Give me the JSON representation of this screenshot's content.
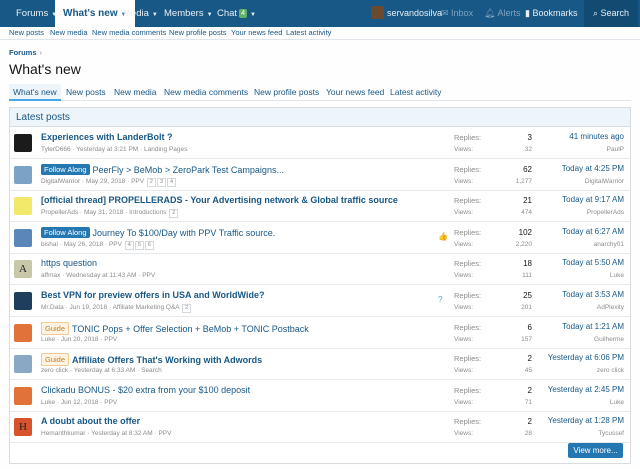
{
  "topnav": {
    "forums": "Forums",
    "whats_new": "What's new",
    "media": "Media",
    "members": "Members",
    "chat": "Chat",
    "chat_badge": "4",
    "user": "servandosilva",
    "inbox": "Inbox",
    "alerts": "Alerts",
    "bookmarks": "Bookmarks",
    "search": "Search"
  },
  "subnav": [
    "New posts",
    "New media",
    "New media comments",
    "New profile posts",
    "Your news feed",
    "Latest activity"
  ],
  "breadcrumb": "Forums",
  "page_title": "What's new",
  "tabs": [
    "What's new",
    "New posts",
    "New media",
    "New media comments",
    "New profile posts",
    "Your news feed",
    "Latest activity"
  ],
  "block_title": "Latest posts",
  "stat_labels": {
    "replies": "Replies:",
    "views": "Views:"
  },
  "threads": [
    {
      "label": "",
      "label_style": "",
      "title": "Experiences with LanderBolt ?",
      "bold": true,
      "author": "TylerD666",
      "date": "Yesterday at 3:21 PM",
      "forum": "Landing Pages",
      "pages": "",
      "replies": "3",
      "views": "32",
      "last_time": "41 minutes ago",
      "last_user": "PaulP",
      "avatar_color": "#1b1b1b",
      "avatar_letter": "",
      "extra": ""
    },
    {
      "label": "Follow Along",
      "label_style": "blue",
      "title": "PeerFly > BeMob > ZeroPark Test Campaigns...",
      "bold": false,
      "author": "DigitalWarrior",
      "date": "May 29, 2018",
      "forum": "PPV",
      "pages": "2 3 4",
      "replies": "62",
      "views": "1,277",
      "last_time": "Today at 4:25 PM",
      "last_user": "DigitalWarrior",
      "avatar_color": "#7aa3c6",
      "avatar_letter": "",
      "extra": ""
    },
    {
      "label": "",
      "label_style": "",
      "title": "[official thread] PROPELLERADS - Your Advertising network & Global traffic source",
      "bold": true,
      "author": "PropellerAds",
      "date": "May 31, 2018",
      "forum": "Introductions",
      "pages": "2",
      "replies": "21",
      "views": "474",
      "last_time": "Today at 9:17 AM",
      "last_user": "PropellerAds",
      "avatar_color": "#f2e86a",
      "avatar_letter": "",
      "extra": ""
    },
    {
      "label": "Follow Along",
      "label_style": "blue",
      "title": "Journey To $100/Day with PPV Traffic source.",
      "bold": false,
      "author": "bishal",
      "date": "May 26, 2018",
      "forum": "PPV",
      "pages": "4 5 6",
      "replies": "102",
      "views": "2,220",
      "last_time": "Today at 6:27 AM",
      "last_user": "anarchy01",
      "avatar_color": "#5a86b8",
      "avatar_letter": "",
      "extra": "👍"
    },
    {
      "label": "",
      "label_style": "",
      "title": "https question",
      "bold": false,
      "author": "affmax",
      "date": "Wednesday at 11:43 AM",
      "forum": "PPV",
      "pages": "",
      "replies": "18",
      "views": "111",
      "last_time": "Today at 5:50 AM",
      "last_user": "Luke",
      "avatar_color": "#c7c8a8",
      "avatar_letter": "A",
      "extra": ""
    },
    {
      "label": "",
      "label_style": "",
      "title": "Best VPN for preview offers in USA and WorldWide?",
      "bold": true,
      "author": "Mr.Data",
      "date": "Jun 19, 2018",
      "forum": "Affiliate Marketing Q&A",
      "pages": "2",
      "replies": "25",
      "views": "201",
      "last_time": "Today at 3:53 AM",
      "last_user": "AdPlexity",
      "avatar_color": "#1f3d5c",
      "avatar_letter": "",
      "extra": "?"
    },
    {
      "label": "Guide",
      "label_style": "orange",
      "title": "TONIC Pops + Offer Selection + BeMob + TONIC Postback",
      "bold": false,
      "author": "Luke",
      "date": "Jun 20, 2018",
      "forum": "PPV",
      "pages": "",
      "replies": "6",
      "views": "157",
      "last_time": "Today at 1:21 AM",
      "last_user": "Guilherme",
      "avatar_color": "#e0723a",
      "avatar_letter": "",
      "extra": ""
    },
    {
      "label": "Guide",
      "label_style": "orange",
      "title": "Affiliate Offers That's Working with Adwords",
      "bold": true,
      "author": "zero click",
      "date": "Yesterday at 6:33 AM",
      "forum": "Search",
      "pages": "",
      "replies": "2",
      "views": "45",
      "last_time": "Yesterday at 6:06 PM",
      "last_user": "zero click",
      "avatar_color": "#8aa8c4",
      "avatar_letter": "",
      "extra": ""
    },
    {
      "label": "",
      "label_style": "",
      "title": "Clickadu BONUS - $20 extra from your $100 deposit",
      "bold": false,
      "author": "Luke",
      "date": "Jun 12, 2018",
      "forum": "PPV",
      "pages": "",
      "replies": "2",
      "views": "71",
      "last_time": "Yesterday at 2:45 PM",
      "last_user": "Luke",
      "avatar_color": "#e0723a",
      "avatar_letter": "",
      "extra": ""
    },
    {
      "label": "",
      "label_style": "",
      "title": "A doubt about the offer",
      "bold": true,
      "author": "Hemanthkumar",
      "date": "Yesterday at 8:32 AM",
      "forum": "PPV",
      "pages": "",
      "replies": "2",
      "views": "28",
      "last_time": "Yesterday at 1:28 PM",
      "last_user": "Tycussef",
      "avatar_color": "#d9522e",
      "avatar_letter": "H",
      "extra": ""
    }
  ],
  "view_more": "View more..."
}
